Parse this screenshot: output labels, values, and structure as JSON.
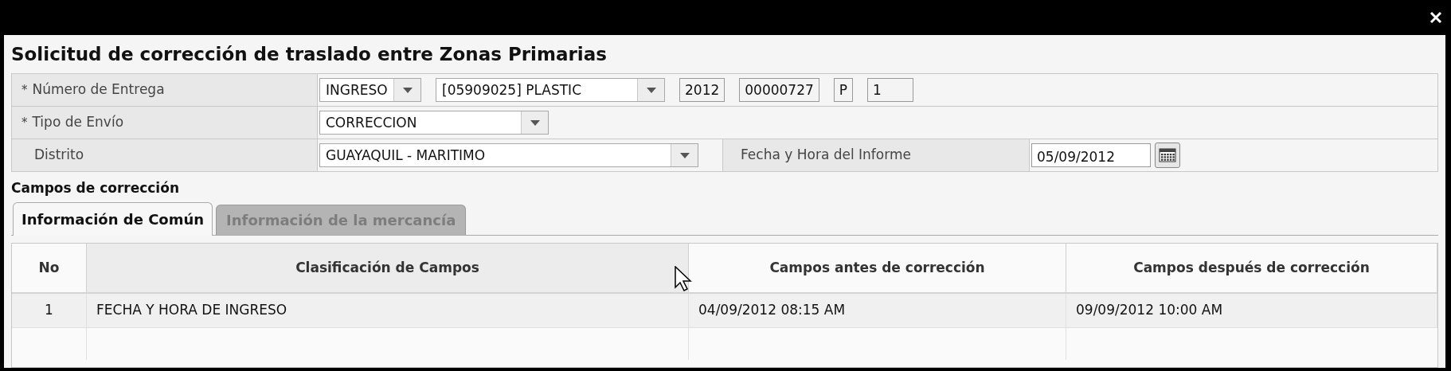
{
  "dialog": {
    "title": "Solicitud de corrección de traslado entre Zonas Primarias"
  },
  "form": {
    "rows": [
      {
        "label": "Número de Entrega",
        "required_mark": "*",
        "fields": [
          {
            "kind": "select",
            "value": "INGRESO"
          },
          {
            "kind": "select",
            "value": "[05909025] PLASTIC"
          },
          {
            "kind": "text",
            "value": "2012"
          },
          {
            "kind": "text",
            "value": "00000727"
          },
          {
            "kind": "text",
            "value": "P"
          },
          {
            "kind": "text",
            "value": "1"
          }
        ]
      },
      {
        "label": "Tipo de Envío",
        "required_mark": "*",
        "fields": [
          {
            "kind": "select",
            "value": "CORRECCION"
          }
        ]
      },
      {
        "label": "Distrito",
        "fields": [
          {
            "kind": "select",
            "value": "GUAYAQUIL - MARITIMO"
          }
        ],
        "second_label": "Fecha y Hora del Informe",
        "second_fields": [
          {
            "kind": "date",
            "value": "05/09/2012"
          }
        ]
      }
    ]
  },
  "section_title": "Campos de corrección",
  "tabs": [
    {
      "label": "Información de Común",
      "selected": true
    },
    {
      "label": "Información de la mercancía",
      "selected": false
    }
  ],
  "table": {
    "columns": [
      "No",
      "Clasificación de Campos",
      "Campos antes de corrección",
      "Campos después de corrección"
    ],
    "rows": [
      [
        "1",
        "FECHA Y HORA DE INGRESO",
        "04/09/2012 08:15 AM",
        "09/09/2012 10:00 AM"
      ]
    ]
  }
}
